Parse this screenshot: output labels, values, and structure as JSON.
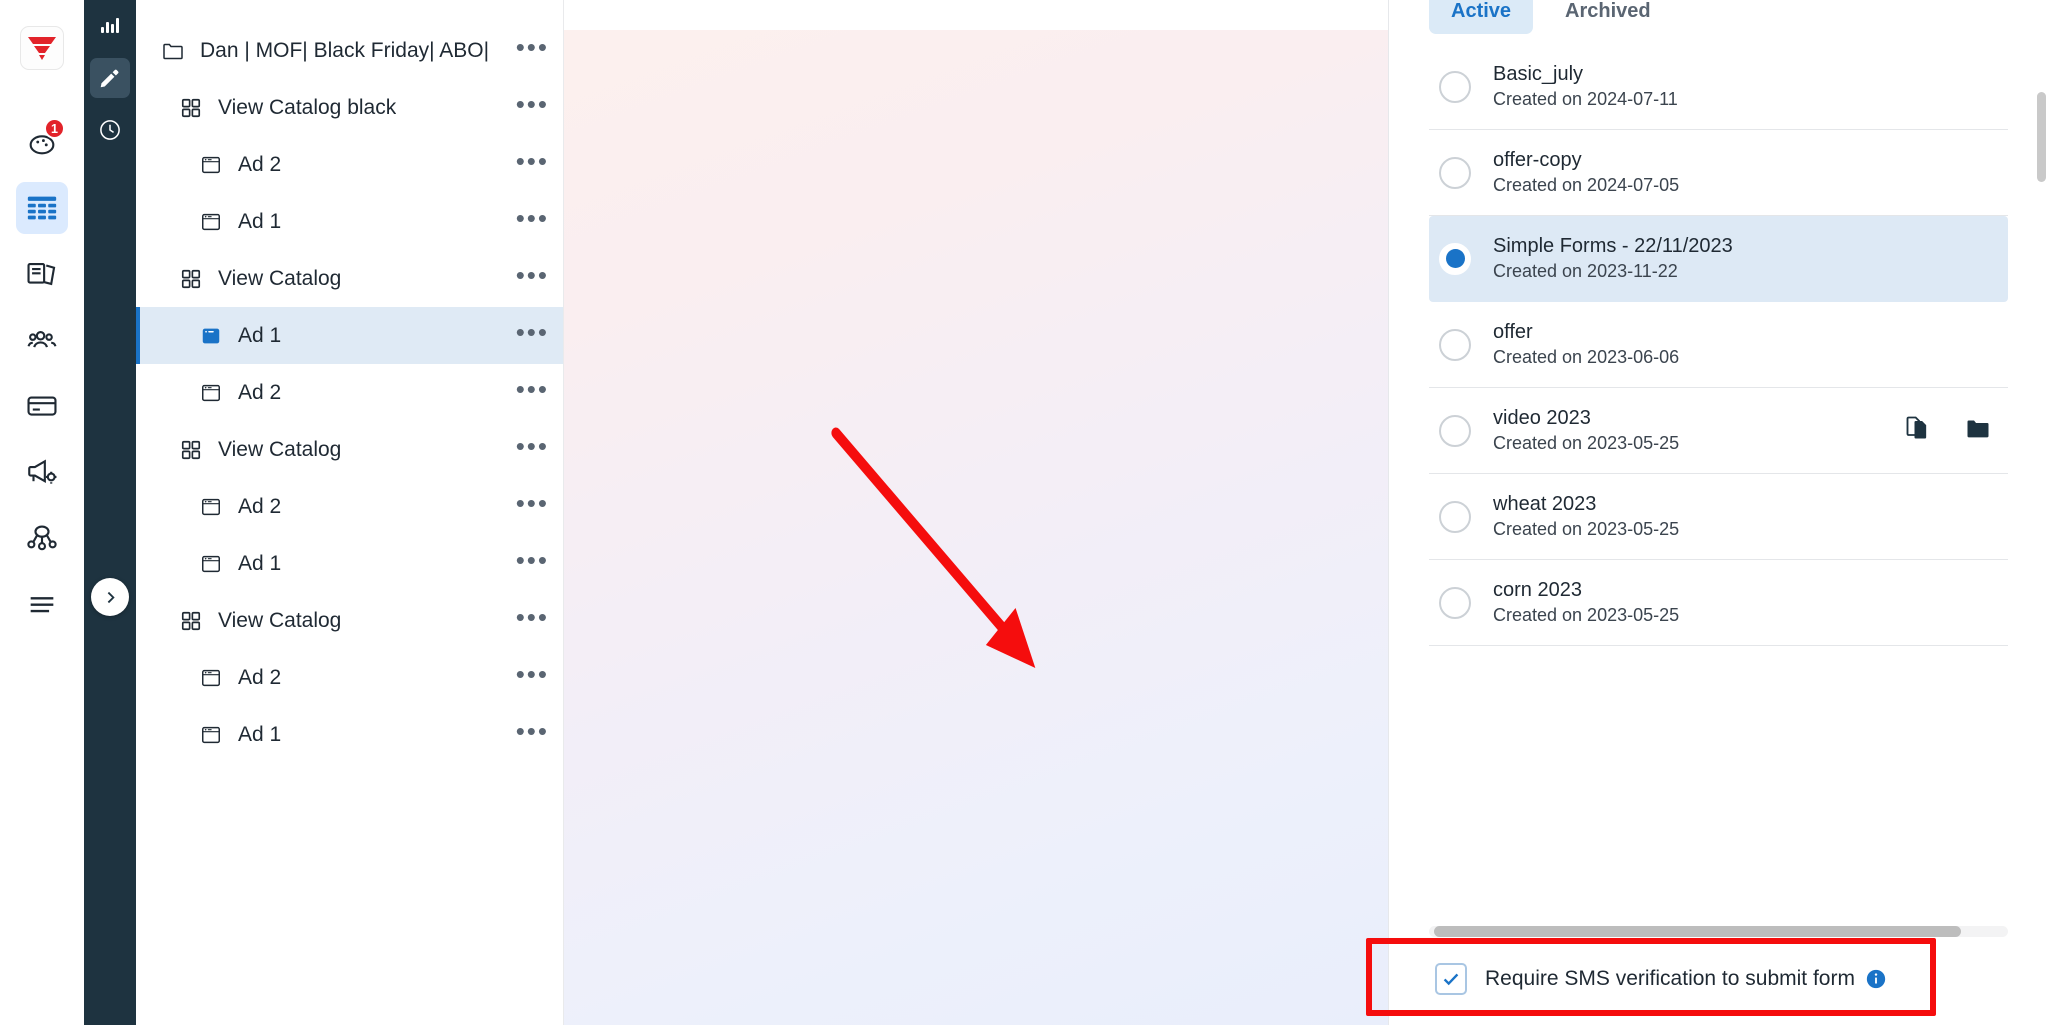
{
  "rail": {
    "logo_icon": "funnel-logo-icon",
    "items": [
      {
        "icon": "palette-icon",
        "name": "palette",
        "badge": "1",
        "active": false
      },
      {
        "icon": "table-grid-icon",
        "name": "tables",
        "badge": "",
        "active": true
      },
      {
        "icon": "pages-icon",
        "name": "pages",
        "badge": "",
        "active": false
      },
      {
        "icon": "contacts-icon",
        "name": "contacts",
        "badge": "",
        "active": false
      },
      {
        "icon": "card-icon",
        "name": "payments",
        "badge": "",
        "active": false
      },
      {
        "icon": "megaphone-settings-icon",
        "name": "campaigns",
        "badge": "",
        "active": false
      },
      {
        "icon": "automation-nodes-icon",
        "name": "automations",
        "badge": "",
        "active": false
      },
      {
        "icon": "menu-icon",
        "name": "more",
        "badge": "",
        "active": false
      }
    ]
  },
  "dark_rail": {
    "items": [
      {
        "icon": "stats-bars-icon",
        "name": "stats",
        "active": false
      },
      {
        "icon": "pencil-edit-icon",
        "name": "edit",
        "active": true
      },
      {
        "icon": "clock-history-icon",
        "name": "history",
        "active": false
      }
    ],
    "expand_icon": "chevron-right-icon"
  },
  "tree": {
    "rows": [
      {
        "label": "Dan | MOF| Black Friday| ABO|",
        "icon": "folder-icon",
        "level": 0,
        "selected": false,
        "menu": "•••"
      },
      {
        "label": "View Catalog black",
        "icon": "grid-squares-icon",
        "level": 1,
        "selected": false,
        "menu": "•••"
      },
      {
        "label": "Ad 2",
        "icon": "window-icon",
        "level": 2,
        "selected": false,
        "menu": "•••"
      },
      {
        "label": "Ad 1",
        "icon": "window-icon",
        "level": 2,
        "selected": false,
        "menu": "•••"
      },
      {
        "label": "View Catalog",
        "icon": "grid-squares-icon",
        "level": 1,
        "selected": false,
        "menu": "•••"
      },
      {
        "label": "Ad 1",
        "icon": "window-filled-icon",
        "level": 2,
        "selected": true,
        "menu": "•••"
      },
      {
        "label": "Ad 2",
        "icon": "window-icon",
        "level": 2,
        "selected": false,
        "menu": "•••"
      },
      {
        "label": "View Catalog",
        "icon": "grid-squares-icon",
        "level": 1,
        "selected": false,
        "menu": "•••"
      },
      {
        "label": "Ad 2",
        "icon": "window-icon",
        "level": 2,
        "selected": false,
        "menu": "•••"
      },
      {
        "label": "Ad 1",
        "icon": "window-icon",
        "level": 2,
        "selected": false,
        "menu": "•••"
      },
      {
        "label": "View Catalog",
        "icon": "grid-squares-icon",
        "level": 1,
        "selected": false,
        "menu": "•••"
      },
      {
        "label": "Ad 2",
        "icon": "window-icon",
        "level": 2,
        "selected": false,
        "menu": "•••"
      },
      {
        "label": "Ad 1",
        "icon": "window-icon",
        "level": 2,
        "selected": false,
        "menu": "•••"
      }
    ]
  },
  "form_panel": {
    "tabs": [
      {
        "label": "Active",
        "active": true
      },
      {
        "label": "Archived",
        "active": false
      }
    ],
    "items": [
      {
        "title": "Basic_july",
        "subtitle": "Created on 2024-07-11",
        "selected": false,
        "actions": []
      },
      {
        "title": "offer-copy",
        "subtitle": "Created on 2024-07-05",
        "selected": false,
        "actions": []
      },
      {
        "title": "Simple Forms - 22/11/2023",
        "subtitle": "Created on 2023-11-22",
        "selected": true,
        "actions": []
      },
      {
        "title": "offer",
        "subtitle": "Created on 2023-06-06",
        "selected": false,
        "actions": []
      },
      {
        "title": "video 2023",
        "subtitle": "Created on 2023-05-25",
        "selected": false,
        "actions": [
          "duplicate-icon",
          "folder-icon"
        ]
      },
      {
        "title": "wheat 2023",
        "subtitle": "Created on 2023-05-25",
        "selected": false,
        "actions": []
      },
      {
        "title": "corn 2023",
        "subtitle": "Created on 2023-05-25",
        "selected": false,
        "actions": []
      }
    ],
    "footer": {
      "checkbox_label": "Require SMS verification to submit form",
      "checkbox_checked": true,
      "info_icon": "info-circle-icon"
    }
  },
  "annotation": {
    "arrow_color": "#f50d0d",
    "highlight_color": "#f50d0d"
  },
  "colors": {
    "accent_blue": "#1a73c7",
    "dark_rail": "#1e3340",
    "selected_row_bg": "#dde9f5",
    "badge_red": "#e2232a"
  }
}
